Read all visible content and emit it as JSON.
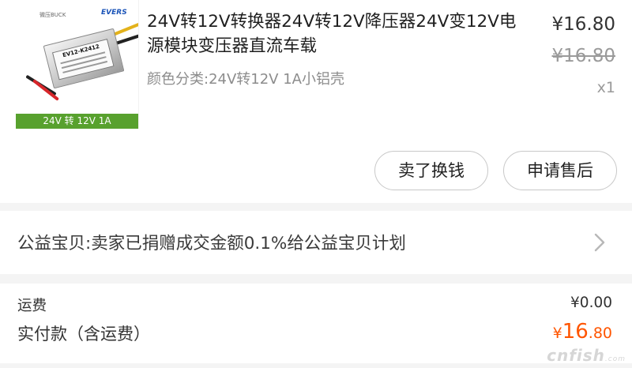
{
  "product": {
    "image": {
      "brand_left": "微压BUCK",
      "brand_right": "EVERS",
      "module_model": "EV12-K2412",
      "caption": "24V 转 12V 1A"
    },
    "title": "24V转12V转换器24V转12V降压器24V变12V电源模块变压器直流车载",
    "variant": "颜色分类:24V转12V 1A小铝壳",
    "price": "¥16.80",
    "original_price": "¥16.80",
    "quantity": "x1",
    "sell_button": "卖了换钱",
    "refund_button": "申请售后"
  },
  "charity": {
    "text": "公益宝贝:卖家已捐赠成交金额0.1%给公益宝贝计划",
    "icon": "chevron-right-icon"
  },
  "totals": {
    "shipping_label": "运费",
    "shipping_value": "¥0.00",
    "paid_label": "实付款（含运费）",
    "paid_currency": "¥",
    "paid_integer": "16",
    "paid_decimal": ".80"
  },
  "watermark": {
    "text": "cnfish",
    "suffix": ".com"
  },
  "colors": {
    "accent": "#ff5500",
    "caption_green": "#58a12e",
    "separator": "#f4f4f4"
  }
}
